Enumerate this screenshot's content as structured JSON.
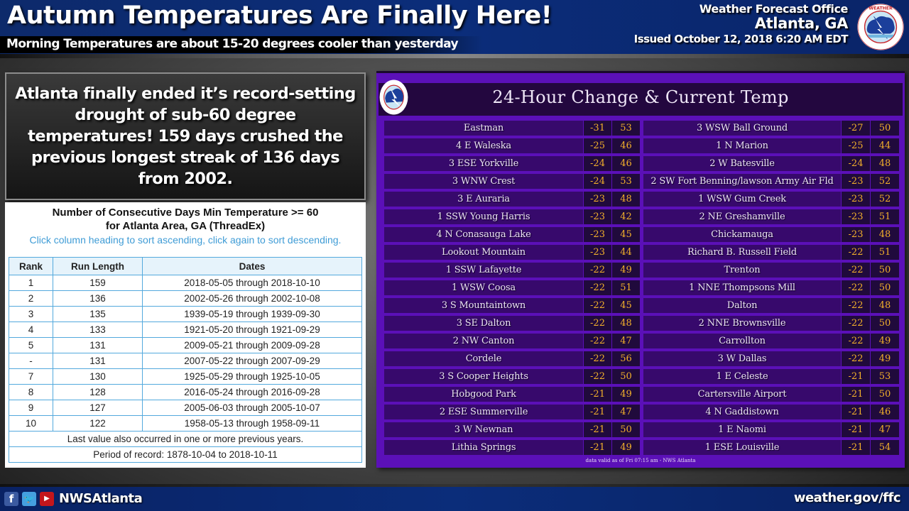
{
  "header": {
    "title": "Autumn Temperatures Are Finally Here!",
    "subtitle": "Morning Temperatures are about 15-20 degrees cooler than yesterday",
    "office_line1": "Weather Forecast Office",
    "office_line2": "Atlanta, GA",
    "issued": "Issued October 12, 2018 6:20 AM EDT",
    "logo_icon": "nws-logo-icon"
  },
  "callout": {
    "text": "Atlanta finally ended it’s record-setting drought of sub-60 degree temperatures! 159 days crushed the previous longest streak of 136 days from 2002."
  },
  "records": {
    "title_line1": "Number of Consecutive Days Min Temperature >= 60",
    "title_line2": "for Atlanta Area, GA (ThreadEx)",
    "hint": "Click column heading to sort ascending, click again to sort descending.",
    "columns": [
      "Rank",
      "Run Length",
      "Dates"
    ],
    "rows": [
      {
        "rank": "1",
        "run_length": "159",
        "dates": "2018-05-05 through 2018-10-10"
      },
      {
        "rank": "2",
        "run_length": "136",
        "dates": "2002-05-26 through 2002-10-08"
      },
      {
        "rank": "3",
        "run_length": "135",
        "dates": "1939-05-19 through 1939-09-30"
      },
      {
        "rank": "4",
        "run_length": "133",
        "dates": "1921-05-20 through 1921-09-29"
      },
      {
        "rank": "5",
        "run_length": "131",
        "dates": "2009-05-21 through 2009-09-28"
      },
      {
        "rank": "-",
        "run_length": "131",
        "dates": "2007-05-22 through 2007-09-29"
      },
      {
        "rank": "7",
        "run_length": "130",
        "dates": "1925-05-29 through 1925-10-05"
      },
      {
        "rank": "8",
        "run_length": "128",
        "dates": "2016-05-24 through 2016-09-28"
      },
      {
        "rank": "9",
        "run_length": "127",
        "dates": "2005-06-03 through 2005-10-07"
      },
      {
        "rank": "10",
        "run_length": "122",
        "dates": "1958-05-13 through 1958-09-11"
      }
    ],
    "note": "Last value also occurred in one or more previous years.",
    "period": "Period of record: 1878-10-04 to 2018-10-11"
  },
  "panel": {
    "title": "24-Hour Change & Current Temp",
    "valid_note": "data valid as of Fri 07:15 am - NWS Atlanta",
    "colors": {
      "background": "#5b10b8",
      "name_cell": "#37096c",
      "value_cell": "#200a3c",
      "value_text": "#f2b02a"
    },
    "left": [
      {
        "name": "Eastman",
        "change": "-31",
        "temp": "53"
      },
      {
        "name": "4 E Waleska",
        "change": "-25",
        "temp": "46"
      },
      {
        "name": "3 ESE Yorkville",
        "change": "-24",
        "temp": "46"
      },
      {
        "name": "3 WNW Crest",
        "change": "-24",
        "temp": "53"
      },
      {
        "name": "3 E Auraria",
        "change": "-23",
        "temp": "48"
      },
      {
        "name": "1 SSW Young Harris",
        "change": "-23",
        "temp": "42"
      },
      {
        "name": "4 N Conasauga Lake",
        "change": "-23",
        "temp": "45"
      },
      {
        "name": "Lookout Mountain",
        "change": "-23",
        "temp": "44"
      },
      {
        "name": "1 SSW Lafayette",
        "change": "-22",
        "temp": "49"
      },
      {
        "name": "1 WSW Coosa",
        "change": "-22",
        "temp": "51"
      },
      {
        "name": "3 S Mountaintown",
        "change": "-22",
        "temp": "45"
      },
      {
        "name": "3 SE Dalton",
        "change": "-22",
        "temp": "48"
      },
      {
        "name": "2 NW Canton",
        "change": "-22",
        "temp": "47"
      },
      {
        "name": "Cordele",
        "change": "-22",
        "temp": "56"
      },
      {
        "name": "3 S Cooper Heights",
        "change": "-22",
        "temp": "50"
      },
      {
        "name": "Hobgood Park",
        "change": "-21",
        "temp": "49"
      },
      {
        "name": "2 ESE Summerville",
        "change": "-21",
        "temp": "47"
      },
      {
        "name": "3 W Newnan",
        "change": "-21",
        "temp": "50"
      },
      {
        "name": "Lithia Springs",
        "change": "-21",
        "temp": "49"
      }
    ],
    "right": [
      {
        "name": "3 WSW Ball Ground",
        "change": "-27",
        "temp": "50"
      },
      {
        "name": "1 N Marion",
        "change": "-25",
        "temp": "44"
      },
      {
        "name": "2 W Batesville",
        "change": "-24",
        "temp": "48"
      },
      {
        "name": "2 SW Fort Benning/lawson Army Air Fld",
        "change": "-23",
        "temp": "52"
      },
      {
        "name": "1 WSW Gum Creek",
        "change": "-23",
        "temp": "52"
      },
      {
        "name": "2 NE Greshamville",
        "change": "-23",
        "temp": "51"
      },
      {
        "name": "Chickamauga",
        "change": "-23",
        "temp": "48"
      },
      {
        "name": "Richard B. Russell Field",
        "change": "-22",
        "temp": "51"
      },
      {
        "name": "Trenton",
        "change": "-22",
        "temp": "50"
      },
      {
        "name": "1 NNE Thompsons Mill",
        "change": "-22",
        "temp": "50"
      },
      {
        "name": "Dalton",
        "change": "-22",
        "temp": "48"
      },
      {
        "name": "2 NNE Brownsville",
        "change": "-22",
        "temp": "50"
      },
      {
        "name": "Carrollton",
        "change": "-22",
        "temp": "49"
      },
      {
        "name": "3 W Dallas",
        "change": "-22",
        "temp": "49"
      },
      {
        "name": "1 E Celeste",
        "change": "-21",
        "temp": "53"
      },
      {
        "name": "Cartersville Airport",
        "change": "-21",
        "temp": "50"
      },
      {
        "name": "4 N Gaddistown",
        "change": "-21",
        "temp": "46"
      },
      {
        "name": "1 E Naomi",
        "change": "-21",
        "temp": "47"
      },
      {
        "name": "1 ESE Louisville",
        "change": "-21",
        "temp": "54"
      }
    ]
  },
  "footer": {
    "social_icons": [
      "facebook-icon",
      "twitter-icon",
      "youtube-icon"
    ],
    "handle": "NWSAtlanta",
    "website": "weather.gov/ffc"
  }
}
